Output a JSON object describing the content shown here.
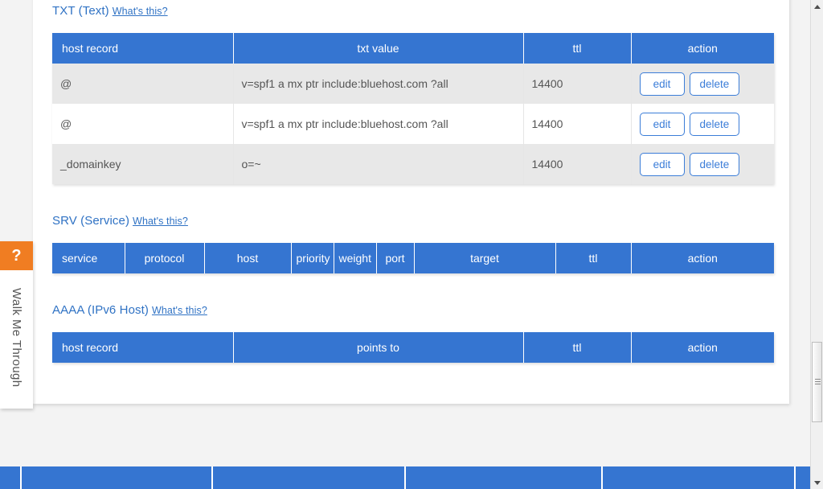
{
  "sections": [
    {
      "id": "txt",
      "title": "TXT (Text)",
      "help_link": "What's this?",
      "columns": [
        "host record",
        "txt value",
        "ttl",
        "action"
      ],
      "rows": [
        {
          "host": "@",
          "value": "v=spf1 a mx ptr include:bluehost.com ?all",
          "ttl": "14400",
          "edit": "edit",
          "delete": "delete"
        },
        {
          "host": "@",
          "value": "v=spf1 a mx ptr include:bluehost.com ?all",
          "ttl": "14400",
          "edit": "edit",
          "delete": "delete"
        },
        {
          "host": "_domainkey",
          "value": "o=~",
          "ttl": "14400",
          "edit": "edit",
          "delete": "delete"
        }
      ]
    },
    {
      "id": "srv",
      "title": "SRV (Service)",
      "help_link": "What's this?",
      "columns": [
        "service",
        "protocol",
        "host",
        "priority",
        "weight",
        "port",
        "target",
        "ttl",
        "action"
      ],
      "rows": []
    },
    {
      "id": "aaaa",
      "title": "AAAA (IPv6 Host)",
      "help_link": "What's this?",
      "columns": [
        "host record",
        "points to",
        "ttl",
        "action"
      ],
      "rows": []
    }
  ],
  "walk_widget": {
    "question_mark": "?",
    "label": "Walk Me Through"
  },
  "colors": {
    "table_header_blue": "#3575d1",
    "link_blue": "#2f72c4",
    "button_blue": "#3b7dd8",
    "accent_orange": "#f07d22",
    "row_odd": "#e8e8e8",
    "row_even": "#ffffff"
  }
}
